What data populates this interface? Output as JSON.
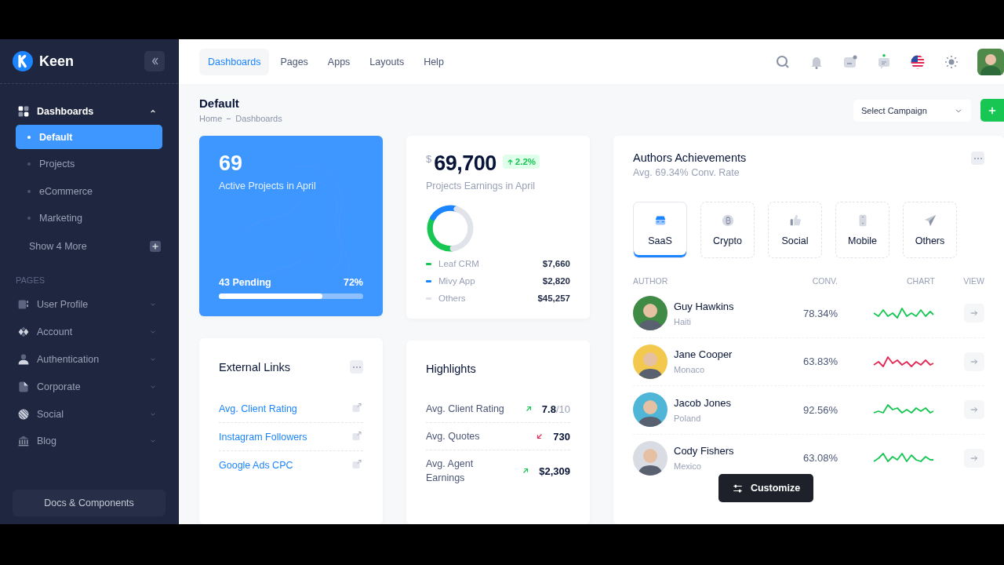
{
  "sidebar": {
    "brand": "Keen",
    "menu": [
      {
        "label": "Dashboards",
        "expanded": true,
        "children": [
          {
            "label": "Default",
            "selected": true
          },
          {
            "label": "Projects",
            "selected": false
          },
          {
            "label": "eCommerce",
            "selected": false
          },
          {
            "label": "Marketing",
            "selected": false
          }
        ]
      }
    ],
    "show_more": "Show 4 More",
    "section_title": "PAGES",
    "pages": [
      {
        "label": "User Profile",
        "expanded": false
      },
      {
        "label": "Account",
        "expanded": false
      },
      {
        "label": "Authentication",
        "expanded": false
      },
      {
        "label": "Corporate",
        "expanded": false
      },
      {
        "label": "Social",
        "expanded": false
      },
      {
        "label": "Blog",
        "expanded": false
      }
    ],
    "footer_button": "Docs & Components"
  },
  "topbar": {
    "nav": [
      {
        "label": "Dashboards",
        "selected": true
      },
      {
        "label": "Pages",
        "selected": false
      },
      {
        "label": "Apps",
        "selected": false
      },
      {
        "label": "Layouts",
        "selected": false
      },
      {
        "label": "Help",
        "selected": false
      }
    ]
  },
  "page_header": {
    "title": "Default",
    "breadcrumb": [
      "Home",
      "Dashboards"
    ],
    "campaign_select": {
      "placeholder": "Select Campaign"
    }
  },
  "active_projects": {
    "count": "69",
    "label": "Active Projects in April",
    "pending": "43 Pending",
    "percent": "72%",
    "level": 0.72
  },
  "earnings": {
    "currency": "$",
    "amount": "69,700",
    "change": "2.2%",
    "label": "Projects Earnings in April",
    "legend": [
      {
        "name": "Leaf CRM",
        "value": "$7,660",
        "color": "#17c653"
      },
      {
        "name": "Mivy App",
        "value": "$2,820",
        "color": "#1b84ff"
      },
      {
        "name": "Others",
        "value": "$45,257",
        "color": "#e1e3ea"
      }
    ]
  },
  "external_links": {
    "title": "External Links",
    "links": [
      "Avg. Client Rating",
      "Instagram Followers",
      "Google Ads CPC"
    ]
  },
  "highlights": {
    "title": "Highlights",
    "rows": [
      {
        "label": "Avg. Client Rating",
        "kind": "up",
        "value": "7.8",
        "suffix": "/10"
      },
      {
        "label": "Avg. Quotes",
        "kind": "down",
        "value": "730"
      },
      {
        "label": "Avg. Agent Earnings",
        "kind": "up",
        "value": "$2,309"
      }
    ]
  },
  "authors": {
    "title": "Authors Achievements",
    "subtitle": "Avg. 69.34% Conv. Rate",
    "categories": [
      {
        "label": "SaaS",
        "selected": true
      },
      {
        "label": "Crypto",
        "selected": false
      },
      {
        "label": "Social",
        "selected": false
      },
      {
        "label": "Mobile",
        "selected": false
      },
      {
        "label": "Others",
        "selected": false
      }
    ],
    "columns": [
      "AUTHOR",
      "CONV.",
      "CHART",
      "VIEW"
    ],
    "rows": [
      {
        "name": "Guy Hawkins",
        "country": "Haiti",
        "conv": "78.34%",
        "color": "#17c653"
      },
      {
        "name": "Jane Cooper",
        "country": "Monaco",
        "conv": "63.83%",
        "color": "#e42855"
      },
      {
        "name": "Jacob Jones",
        "country": "Poland",
        "conv": "92.56%",
        "color": "#17c653"
      },
      {
        "name": "Cody Fishers",
        "country": "Mexico",
        "conv": "63.08%",
        "color": "#17c653"
      }
    ]
  },
  "customize_button": "Customize"
}
